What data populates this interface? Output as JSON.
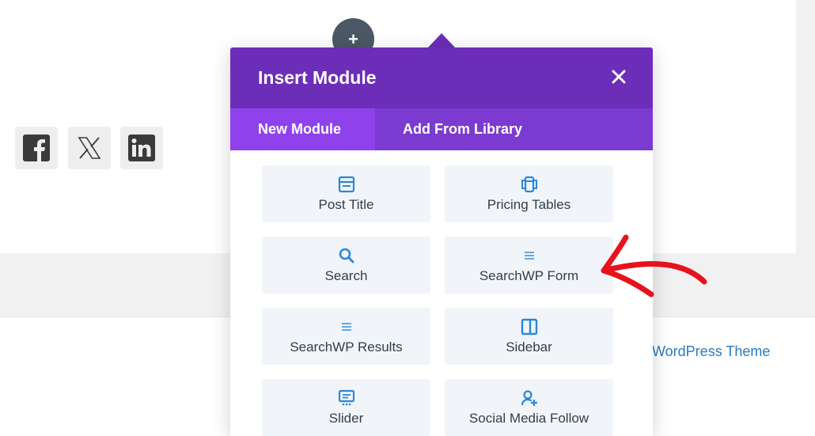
{
  "page": {
    "footer_link": "WordPress Theme"
  },
  "social": [
    {
      "icon": "facebook-icon"
    },
    {
      "icon": "x-twitter-icon"
    },
    {
      "icon": "linkedin-icon"
    }
  ],
  "builder": {
    "add_button_label": "+"
  },
  "modal": {
    "title": "Insert Module",
    "close_icon": "close-icon",
    "tabs": [
      {
        "label": "New Module",
        "active": true
      },
      {
        "label": "Add From Library",
        "active": false
      }
    ],
    "modules": [
      {
        "label": "Post Title",
        "icon": "post-title-icon"
      },
      {
        "label": "Pricing Tables",
        "icon": "pricing-tables-icon"
      },
      {
        "label": "Search",
        "icon": "search-icon"
      },
      {
        "label": "SearchWP Form",
        "icon": "menu-lines-icon"
      },
      {
        "label": "SearchWP Results",
        "icon": "menu-lines-icon"
      },
      {
        "label": "Sidebar",
        "icon": "sidebar-icon"
      },
      {
        "label": "Slider",
        "icon": "slider-icon"
      },
      {
        "label": "Social Media Follow",
        "icon": "social-follow-icon"
      }
    ]
  },
  "colors": {
    "header_purple": "#6c2eb9",
    "tab_bar_purple": "#7b3ad0",
    "active_tab_purple": "#8f42ec",
    "icon_blue": "#2b87da",
    "annotation_red": "#e8121d",
    "link_blue": "#2a7bbf"
  }
}
